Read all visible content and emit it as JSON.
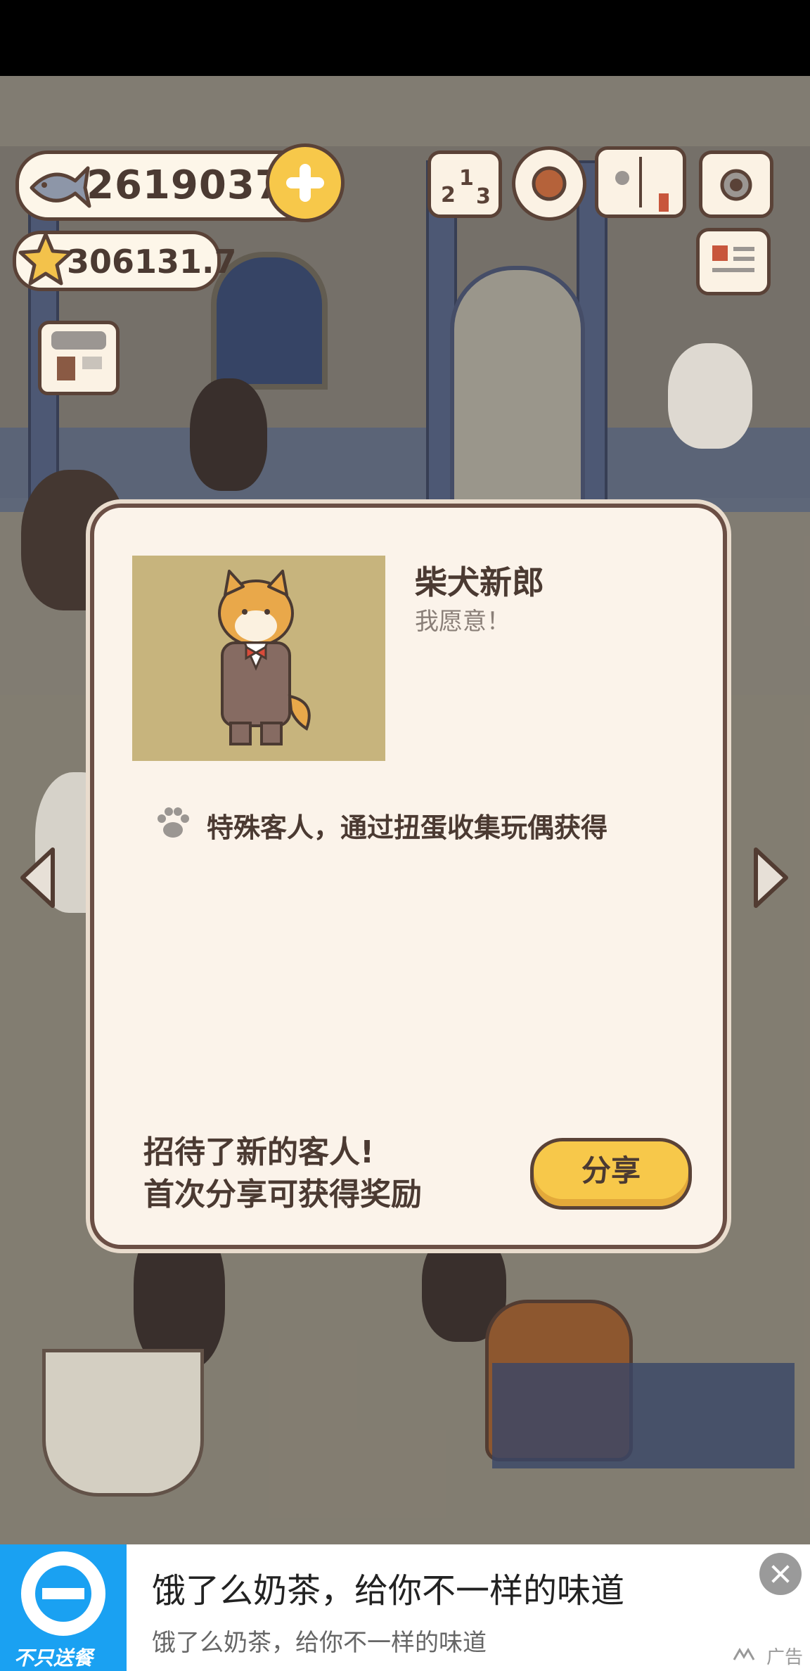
{
  "hud": {
    "fish_count": "26190379",
    "star_count": "306131.7",
    "icons": [
      "fish-icon",
      "plus-icon",
      "star-icon",
      "shop-icon",
      "ranking-icon",
      "settings-gear-icon",
      "cat-book-icon",
      "camera-icon",
      "newspaper-icon"
    ]
  },
  "modal": {
    "customer_name": "柴犬新郎",
    "customer_quote": "我愿意！",
    "description": "特殊客人，通过扭蛋收集玩偶获得",
    "notice_line1": "招待了新的客人!",
    "notice_line2": "首次分享可获得奖励",
    "share_label": "分享"
  },
  "ad": {
    "logo_caption": "不只送餐",
    "title": "饿了么奶茶，给你不一样的味道",
    "subtitle": "饿了么奶茶，给你不一样的味道",
    "tag": "广告"
  },
  "colors": {
    "modal_bg": "#fbf3ea",
    "border_brown": "#5a4237",
    "button_yellow": "#f7c84a",
    "ad_blue": "#1aa1f2"
  }
}
